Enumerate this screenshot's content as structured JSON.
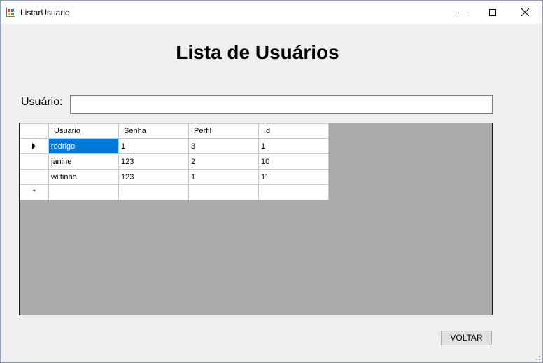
{
  "window": {
    "title": "ListarUsuario",
    "icons": {
      "app": "app-icon",
      "minimize": "minimize-icon",
      "maximize": "maximize-icon",
      "close": "close-icon"
    }
  },
  "heading": "Lista de Usuários",
  "filter": {
    "label": "Usuário:",
    "value": ""
  },
  "grid": {
    "columns": [
      "Usuario",
      "Senha",
      "Perfil",
      "Id"
    ],
    "rows": [
      {
        "marker": "current-row-arrow-icon",
        "cells": [
          "rodrigo",
          "1",
          "3",
          "1"
        ],
        "selected_cell": 0
      },
      {
        "marker": "",
        "cells": [
          "janine",
          "123",
          "2",
          "10"
        ]
      },
      {
        "marker": "",
        "cells": [
          "wiltinho",
          "123",
          "1",
          "11"
        ]
      }
    ],
    "new_row_marker": "*",
    "selection_color": "#0078d7",
    "background_color": "#ababab"
  },
  "buttons": {
    "back_label": "VOLTAR"
  }
}
